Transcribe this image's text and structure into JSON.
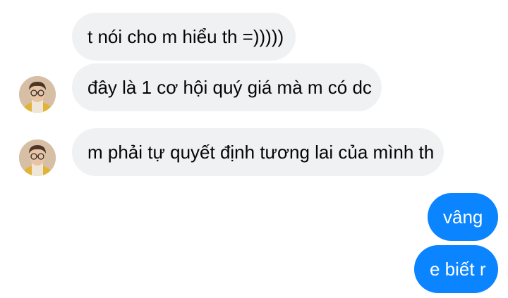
{
  "conversation": {
    "messages": [
      {
        "sender": "other",
        "text": "t nói cho m hiểu th =)))))",
        "show_avatar": false
      },
      {
        "sender": "other",
        "text": "đây là 1 cơ hội quý giá mà m có dc",
        "show_avatar": true
      },
      {
        "sender": "other",
        "text": "m phải tự quyết định tương lai của mình th",
        "show_avatar": true
      },
      {
        "sender": "me",
        "text": "vâng"
      },
      {
        "sender": "me",
        "text": "e biết r"
      }
    ]
  },
  "colors": {
    "incoming_bubble": "#f0f1f3",
    "incoming_text": "#050505",
    "outgoing_bubble": "#0a84ff",
    "outgoing_text": "#ffffff"
  }
}
